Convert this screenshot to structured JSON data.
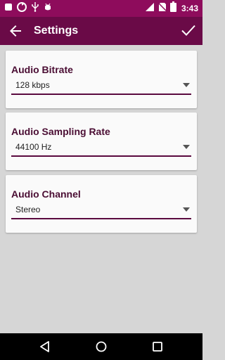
{
  "status_bar": {
    "time": "3:43",
    "notification_icons": [
      "screenshot-icon",
      "sync-icon",
      "usb-icon",
      "android-debug-icon"
    ],
    "system_icons": [
      "signal-icon",
      "no-sim-icon",
      "battery-icon"
    ]
  },
  "app_bar": {
    "title": "Settings",
    "back_icon": "arrow-back-icon",
    "confirm_icon": "checkmark-icon",
    "background": "#6a0a47"
  },
  "settings": {
    "audio_bitrate": {
      "label": "Audio Bitrate",
      "value": "128 kbps"
    },
    "audio_sampling_rate": {
      "label": "Audio Sampling Rate",
      "value": "44100 Hz"
    },
    "audio_channel": {
      "label": "Audio Channel",
      "value": "Stereo"
    }
  },
  "nav_bar": {
    "buttons": [
      "back-triangle-icon",
      "home-circle-icon",
      "recents-square-icon"
    ]
  },
  "colors": {
    "status_bar": "#8e0c5c",
    "accent": "#5a0a3f",
    "label_text": "#4a0d33",
    "background": "#d6d6d6"
  }
}
